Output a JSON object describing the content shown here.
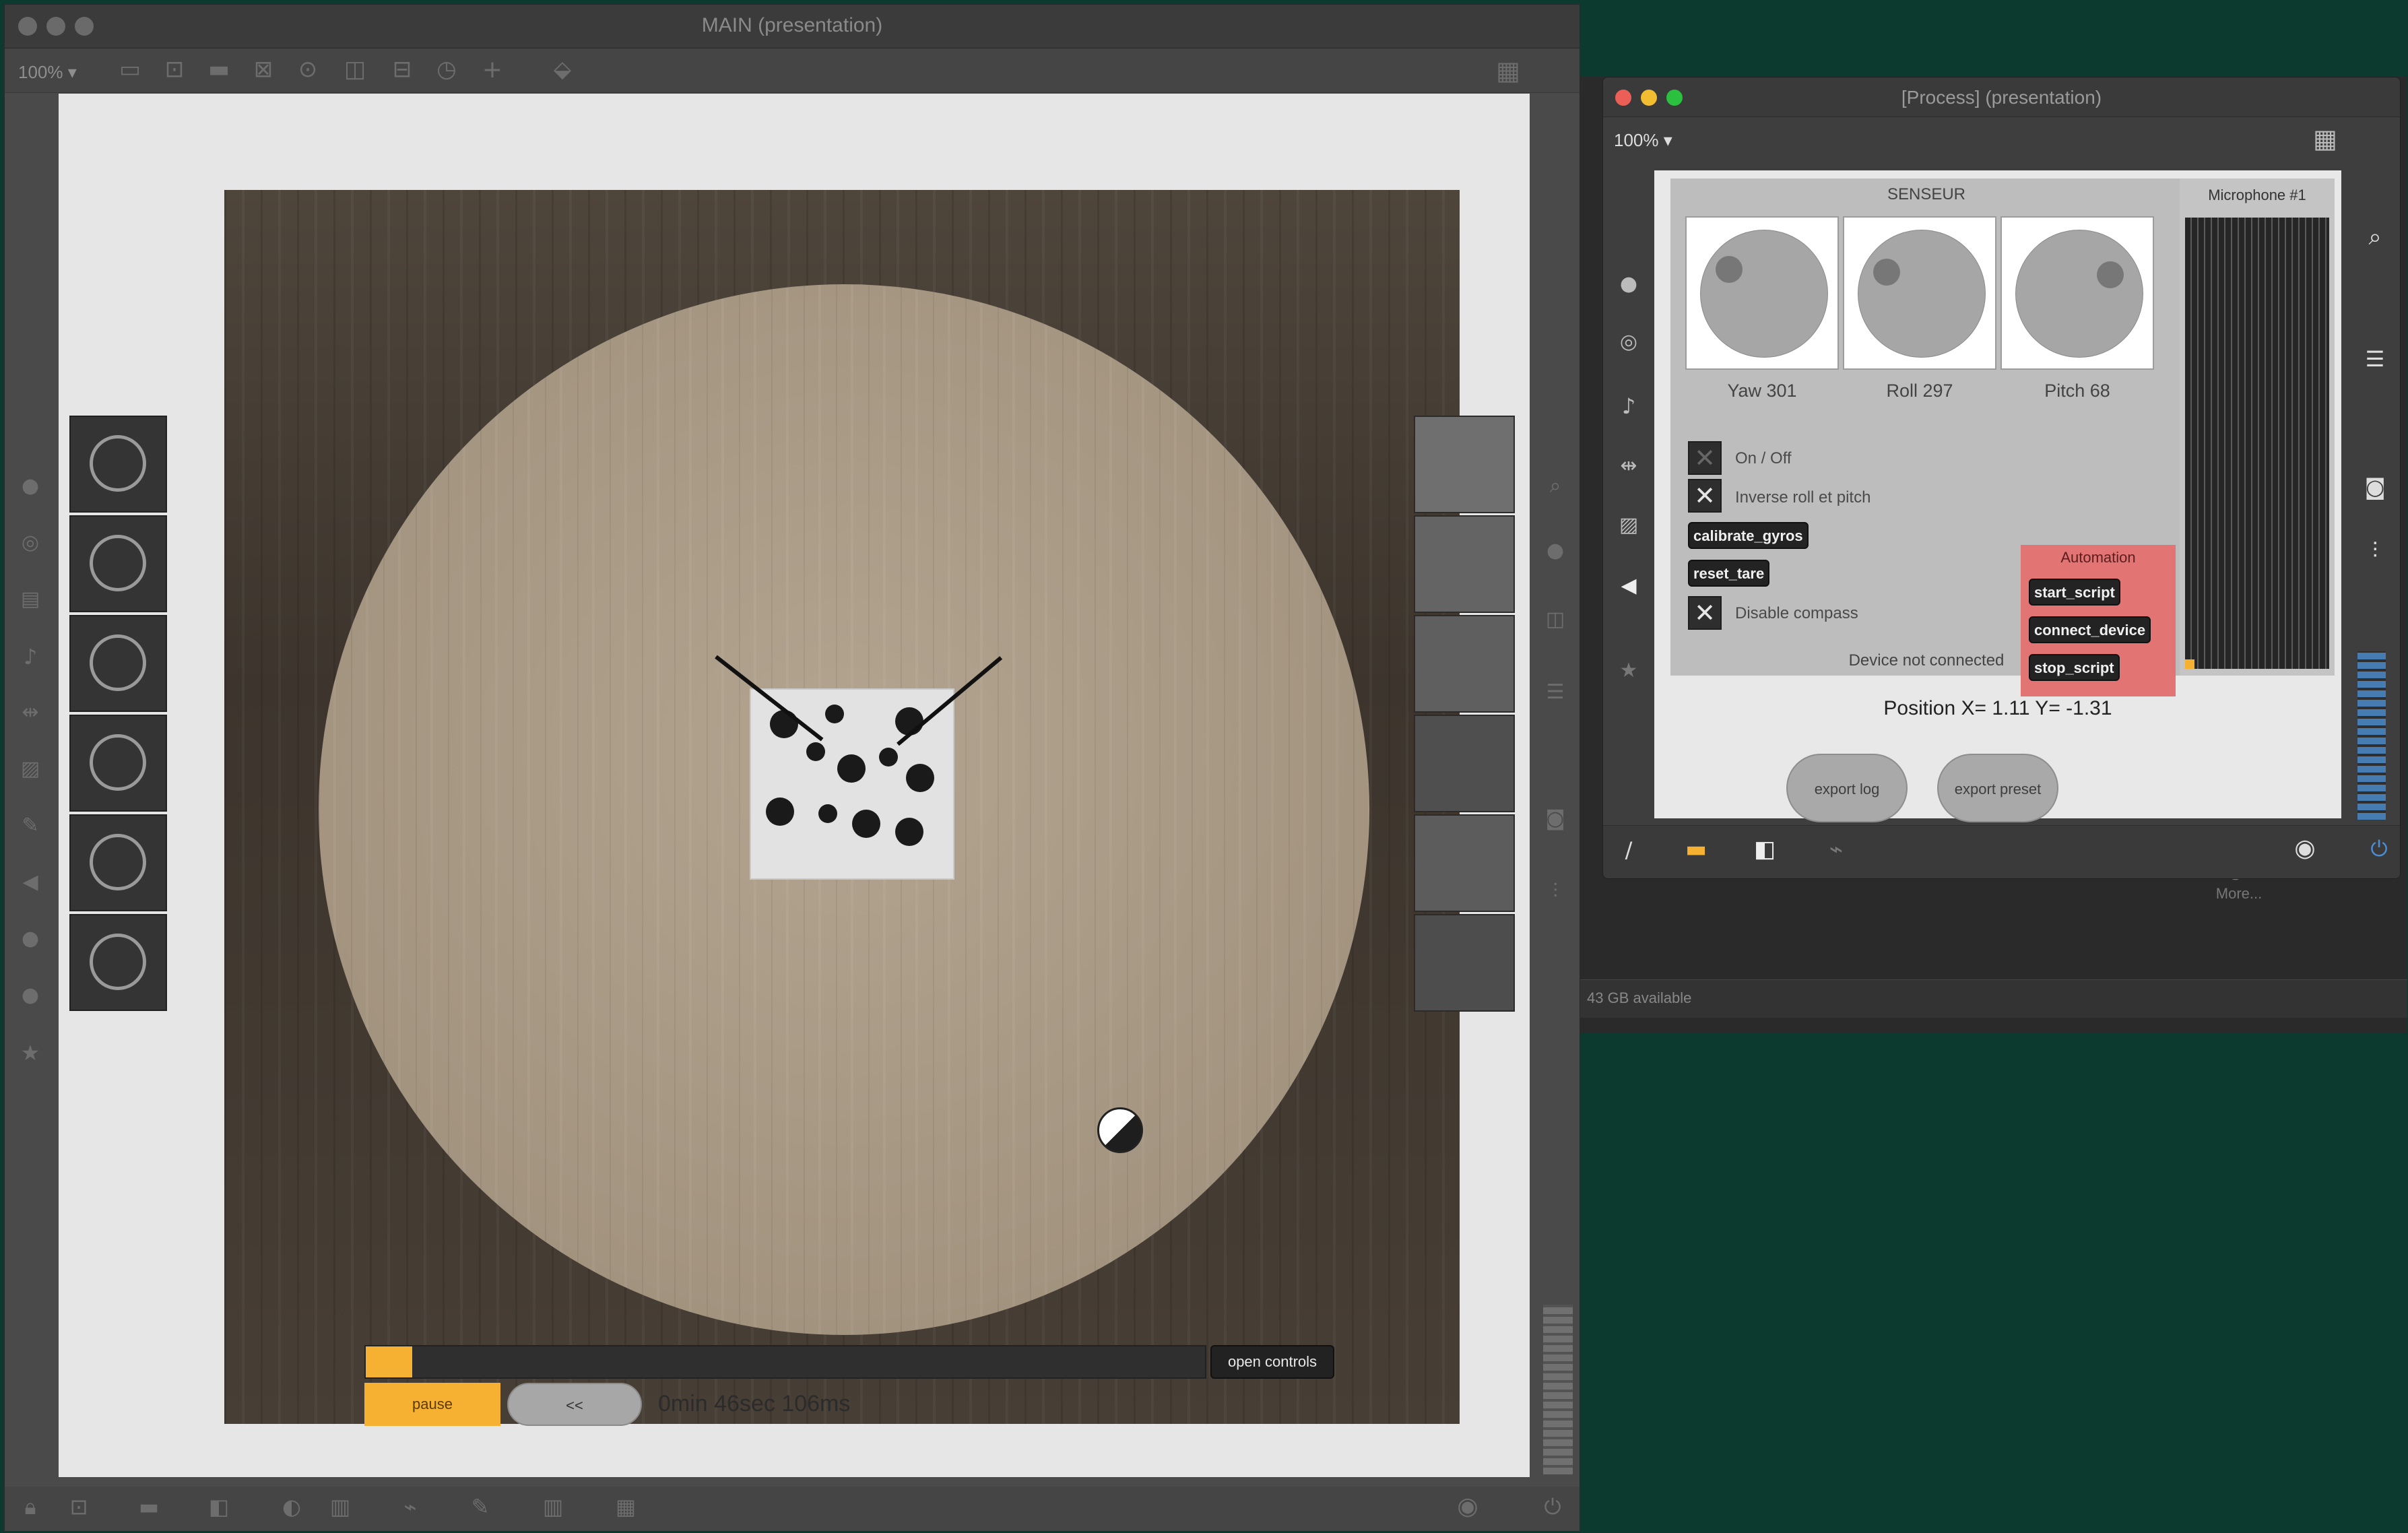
{
  "main": {
    "title": "MAIN (presentation)",
    "zoom": "100%",
    "open_controls": "open controls",
    "pause": "pause",
    "rewind": "<<",
    "elapsed": "0min 46sec 106ms",
    "progress_fraction": 0.055,
    "pads_left": 6,
    "tile_colors": [
      "#6f6f6f",
      "#646464",
      "#5f5f5f",
      "#4f4f4f",
      "#5c5c5c",
      "#4d4d4d"
    ]
  },
  "process": {
    "title": "[Process] (presentation)",
    "zoom": "100%",
    "sensor_title": "SENSEUR",
    "knobs": [
      {
        "label": "Yaw 301"
      },
      {
        "label": "Roll 297"
      },
      {
        "label": "Pitch 68"
      }
    ],
    "checks": {
      "on_off": {
        "label": "On / Off",
        "checked": false
      },
      "inverse": {
        "label": "Inverse roll et pitch",
        "checked": true
      },
      "disable_compass": {
        "label": "Disable compass",
        "checked": true
      }
    },
    "buttons": {
      "calibrate": "calibrate_gyros",
      "reset": "reset_tare",
      "start": "start_script",
      "connect": "connect_device",
      "stop": "stop_script"
    },
    "automation_label": "Automation",
    "device_status": "Device not connected",
    "mic_label": "Microphone #1",
    "position_text": "Position X= 1.11 Y= -1.31",
    "export_log": "export log",
    "export_preset": "export preset"
  },
  "background": {
    "more": "More...",
    "available": "43 GB available"
  },
  "colors": {
    "accent": "#f6b032",
    "automation": "#e27474",
    "background": "#0c3a2e"
  }
}
